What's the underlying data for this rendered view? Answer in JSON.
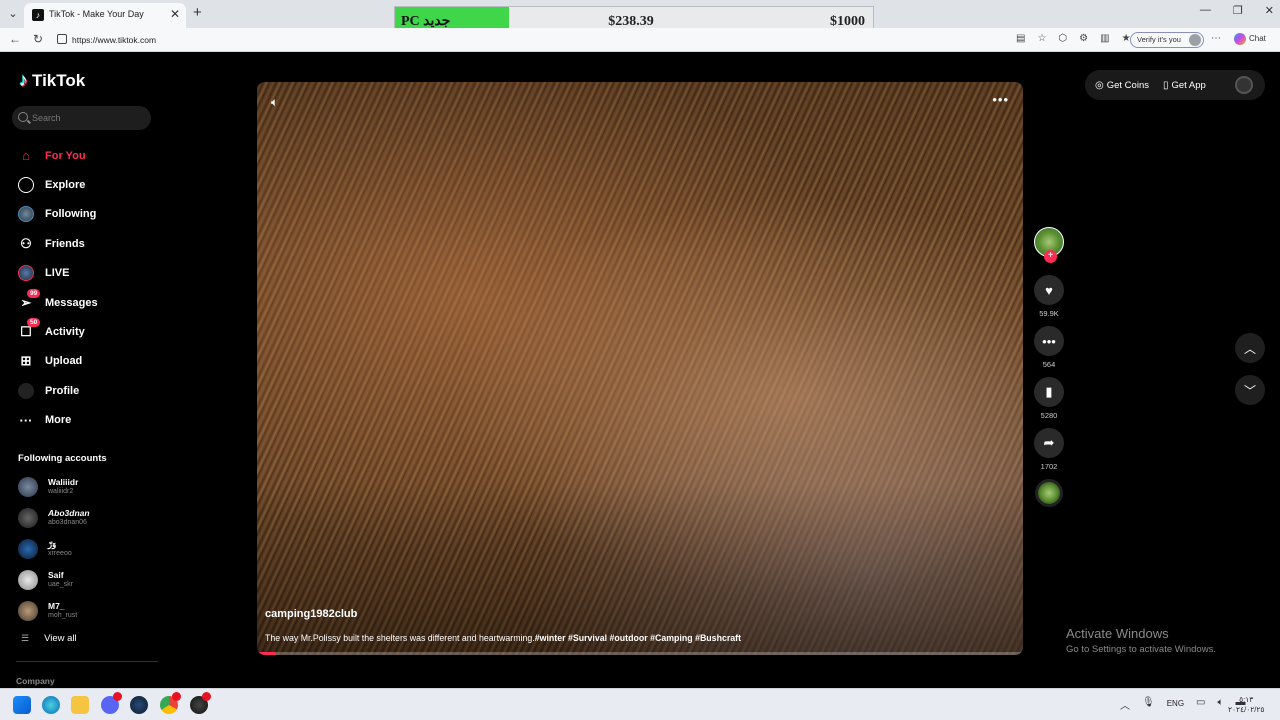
{
  "browser": {
    "tab_title": "TikTok - Make Your Day",
    "url": "https://www.tiktok.com",
    "verify_label": "Verify it's you",
    "chat_label": "Chat"
  },
  "overlay": {
    "label": "PC جديد",
    "price": "$238.39",
    "goal": "$1000"
  },
  "sidebar": {
    "logo": "TikTok",
    "search_placeholder": "Search",
    "nav": [
      {
        "label": "For You",
        "active": true
      },
      {
        "label": "Explore"
      },
      {
        "label": "Following"
      },
      {
        "label": "Friends"
      },
      {
        "label": "LIVE"
      },
      {
        "label": "Messages",
        "badge": "99"
      },
      {
        "label": "Activity",
        "badge": "50"
      },
      {
        "label": "Upload"
      },
      {
        "label": "Profile"
      },
      {
        "label": "More"
      }
    ],
    "following_heading": "Following accounts",
    "accounts": [
      {
        "name": "Waliiidr",
        "user": "waliiidr2"
      },
      {
        "name": "Abo3dnan",
        "user": "abo3dnan06"
      },
      {
        "name": "وَرّ",
        "user": "xrreeoo"
      },
      {
        "name": "Saif",
        "user": "uae_skr"
      },
      {
        "name": "M7_",
        "user": "moh_rust"
      }
    ],
    "view_all": "View all",
    "company": "Company"
  },
  "video": {
    "author": "camping1982club",
    "caption": "The way Mr.Polissy built the shelters was different and heartwarming.",
    "hashtags": "#winter #Survival #outdoor  #Camping #Bushcraft",
    "progress": 0.025
  },
  "actions": {
    "likes": "59.9K",
    "comments": "564",
    "saves": "5280",
    "shares": "1702"
  },
  "top_right": {
    "get_coins": "Get Coins",
    "get_app": "Get App"
  },
  "windows": {
    "activate_title": "Activate Windows",
    "activate_sub": "Go to Settings to activate Windows.",
    "lang": "ENG",
    "time": "٥:١٣",
    "date": "٢٠٢٤/٠٢/٢٥"
  },
  "colors": {
    "accent": "#fe2c55",
    "overlay_green": "#3fd64a"
  }
}
